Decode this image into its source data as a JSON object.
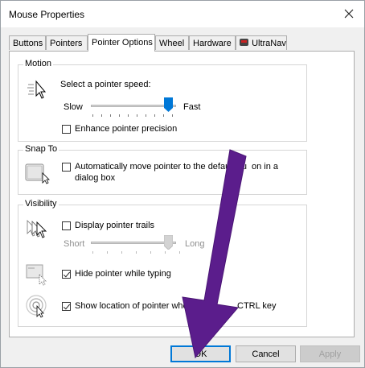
{
  "window": {
    "title": "Mouse Properties"
  },
  "tabs": [
    {
      "label": "Buttons",
      "active": false
    },
    {
      "label": "Pointers",
      "active": false
    },
    {
      "label": "Pointer Options",
      "active": true
    },
    {
      "label": "Wheel",
      "active": false
    },
    {
      "label": "Hardware",
      "active": false
    },
    {
      "label": "UltraNav",
      "active": false
    }
  ],
  "motion": {
    "group_label": "Motion",
    "speed_label": "Select a pointer speed:",
    "slow_label": "Slow",
    "fast_label": "Fast",
    "speed_value": 1.0,
    "enhance_label": "Enhance pointer precision",
    "enhance_checked": false
  },
  "snap_to": {
    "group_label": "Snap To",
    "snap_label_line1": "Automatically move pointer to the default bu",
    "snap_label_line1_end": "on in a",
    "snap_label_line2": "dialog box",
    "snap_checked": false
  },
  "visibility": {
    "group_label": "Visibility",
    "trails_label": "Display pointer trails",
    "trails_checked": false,
    "short_label": "Short",
    "long_label": "Long",
    "trails_value": 1.0,
    "hide_label": "Hide pointer while typing",
    "hide_checked": true,
    "show_location_label": "Show location of pointer when",
    "show_location_label_end": "CTRL key",
    "show_location_checked": true
  },
  "buttons": {
    "ok_label": "OK",
    "cancel_label": "Cancel",
    "apply_label": "Apply"
  },
  "colors": {
    "accent": "#0078d7",
    "annotation_arrow": "#5b1d8c"
  },
  "icons": {
    "close": "close-icon",
    "motion": "pointer-speed-icon",
    "snap": "snap-to-icon",
    "trails": "pointer-trails-icon",
    "hide": "hide-pointer-icon",
    "show_location": "show-location-icon"
  }
}
